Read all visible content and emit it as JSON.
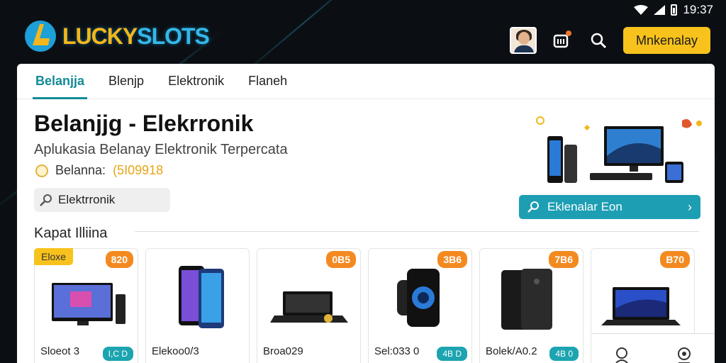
{
  "status": {
    "time": "19:37"
  },
  "app": {
    "logo_lucky": "LUCKY",
    "logo_slots": "SLOTS"
  },
  "header": {
    "cta_label": "Mnkenalay"
  },
  "tabs": [
    {
      "label": "Belanjja"
    },
    {
      "label": "Blenjp"
    },
    {
      "label": "Elektronik"
    },
    {
      "label": "Flaneh"
    }
  ],
  "hero": {
    "title": "Belanjjg - Elekrronik",
    "subtitle": "Aplukasia Belanay Elektronik Terpercata",
    "balance_label": "Belanna:",
    "balance_value": "(5I09918",
    "search_value": "Elektrronik",
    "promo_label": "Eklenalar Eon"
  },
  "section": {
    "title": "Kapat Illiina"
  },
  "products": [
    {
      "price": "820",
      "name": "Sloeot 3",
      "tag": "I,C D",
      "ribbon": "Eloxe"
    },
    {
      "price": "",
      "name": "Elekoo0/3",
      "tag": ""
    },
    {
      "price": "0B5",
      "name": "Broa029",
      "tag": ""
    },
    {
      "price": "3B6",
      "name": "Sel:033 0",
      "tag": "4B D"
    },
    {
      "price": "7B6",
      "name": "Bolek/A0.2",
      "tag": "4B 0"
    },
    {
      "price": "B70",
      "name": "",
      "tag": ""
    }
  ],
  "colors": {
    "accent": "#148b98",
    "cta": "#f7c21c",
    "badge": "#f38a20"
  }
}
